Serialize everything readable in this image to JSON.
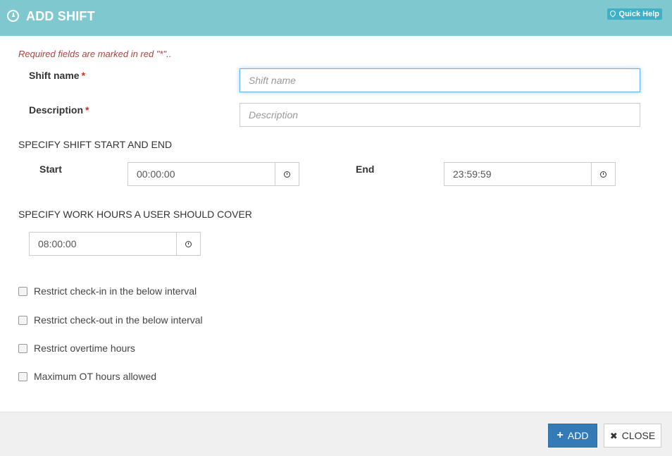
{
  "header": {
    "title": "ADD SHIFT",
    "icon": "clock-icon",
    "quick_help_label": "Quick Help",
    "background_color": "#80c8d0"
  },
  "form": {
    "required_note": "Required fields are marked in red \"*\"..",
    "shift_name": {
      "label": "Shift name",
      "required_mark": "*",
      "placeholder": "Shift name",
      "value": ""
    },
    "description": {
      "label": "Description",
      "required_mark": "*",
      "placeholder": "Description",
      "value": ""
    },
    "shift_section_title": "SPECIFY SHIFT START AND END",
    "start": {
      "label": "Start",
      "value": "00:00:00"
    },
    "end": {
      "label": "End",
      "value": "23:59:59"
    },
    "work_hours_section_title": "SPECIFY WORK HOURS A USER SHOULD COVER",
    "work_hours": {
      "value": "08:00:00"
    },
    "checkboxes": [
      {
        "label": "Restrict check-in in the below interval",
        "checked": false
      },
      {
        "label": "Restrict check-out in the below interval",
        "checked": false
      },
      {
        "label": "Restrict overtime hours",
        "checked": false
      },
      {
        "label": "Maximum OT hours allowed",
        "checked": false
      }
    ]
  },
  "footer": {
    "add_label": "ADD",
    "close_label": "CLOSE",
    "add_color": "#337ab7"
  }
}
